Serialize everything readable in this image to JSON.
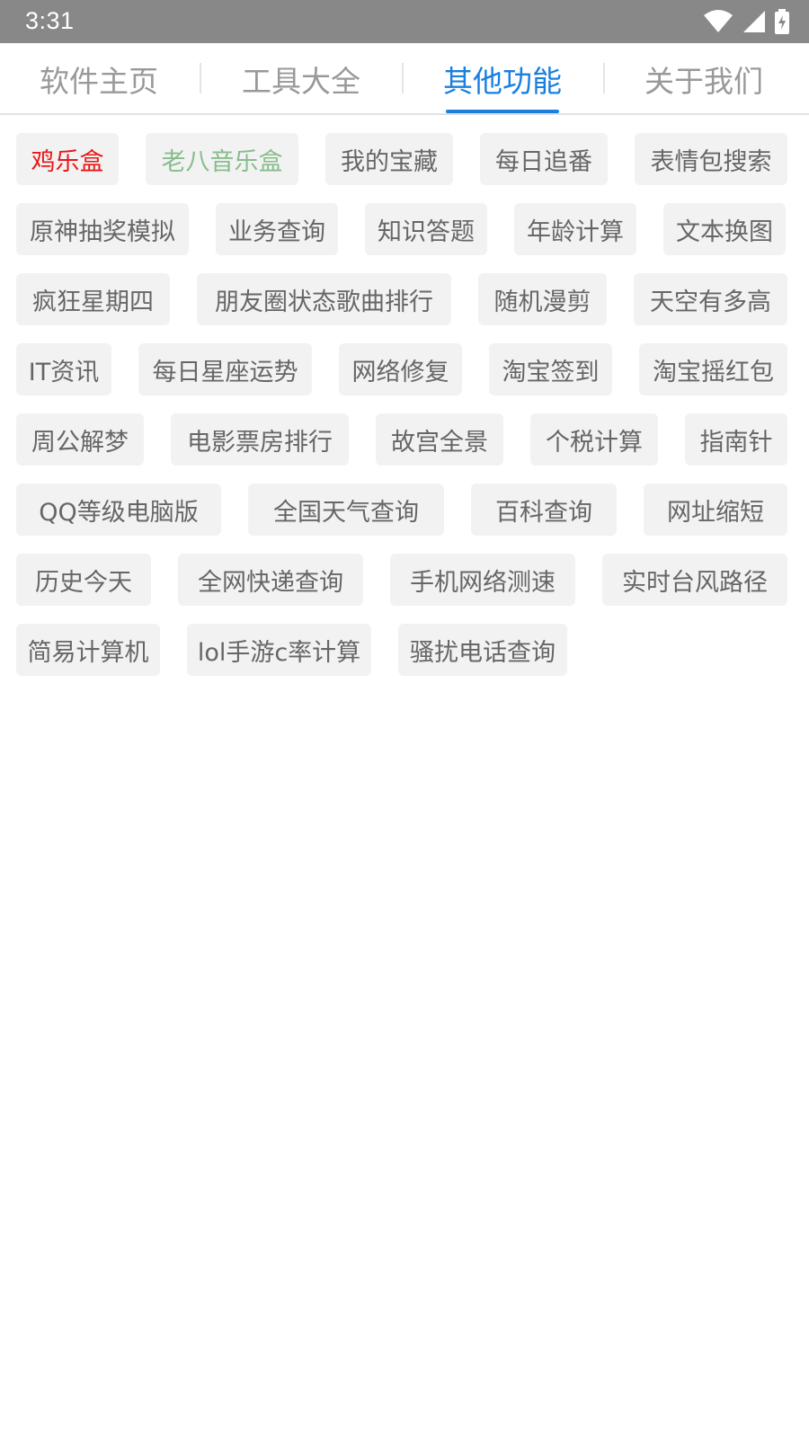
{
  "status_bar": {
    "time": "3:31",
    "icons": [
      "wifi-icon",
      "cellular-signal-icon",
      "battery-charging-icon"
    ]
  },
  "tabs": [
    {
      "label": "软件主页",
      "active": false
    },
    {
      "label": "工具大全",
      "active": false
    },
    {
      "label": "其他功能",
      "active": true
    },
    {
      "label": "关于我们",
      "active": false
    }
  ],
  "colors": {
    "accent": "#1a7fe0",
    "tag_red": "#e81818",
    "tag_green": "#88bd8c",
    "tag_text": "#666666",
    "tag_bg": "#f2f2f2",
    "status_bar": "#888888"
  },
  "tags": [
    {
      "label": "鸡乐盒",
      "style": "red"
    },
    {
      "label": "老八音乐盒",
      "style": "green"
    },
    {
      "label": "我的宝藏"
    },
    {
      "label": "每日追番"
    },
    {
      "label": "表情包搜索"
    },
    {
      "label": "原神抽奖模拟"
    },
    {
      "label": "业务查询"
    },
    {
      "label": "知识答题"
    },
    {
      "label": "年龄计算"
    },
    {
      "label": "文本换图"
    },
    {
      "label": "疯狂星期四"
    },
    {
      "label": "朋友圈状态歌曲排行"
    },
    {
      "label": "随机漫剪"
    },
    {
      "label": "天空有多高"
    },
    {
      "label": "IT资讯"
    },
    {
      "label": "每日星座运势"
    },
    {
      "label": "网络修复"
    },
    {
      "label": "淘宝签到"
    },
    {
      "label": "淘宝摇红包"
    },
    {
      "label": "周公解梦"
    },
    {
      "label": "电影票房排行"
    },
    {
      "label": "故宫全景"
    },
    {
      "label": "个税计算"
    },
    {
      "label": "指南针"
    },
    {
      "label": "QQ等级电脑版"
    },
    {
      "label": "全国天气查询"
    },
    {
      "label": "百科查询"
    },
    {
      "label": "网址缩短"
    },
    {
      "label": "历史今天"
    },
    {
      "label": "全网快递查询"
    },
    {
      "label": "手机网络测速"
    },
    {
      "label": "实时台风路径"
    },
    {
      "label": "简易计算机"
    },
    {
      "label": "lol手游c率计算"
    },
    {
      "label": "骚扰电话查询"
    }
  ]
}
